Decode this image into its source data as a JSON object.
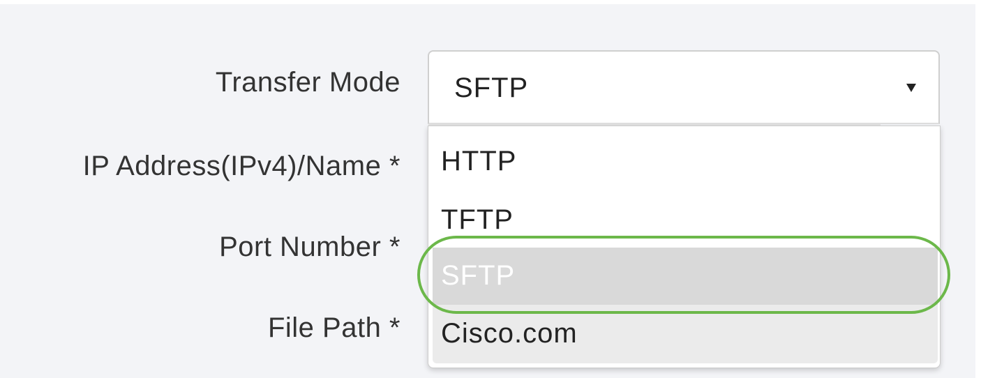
{
  "form": {
    "transfer_mode_label": "Transfer Mode",
    "ip_label": "IP Address(IPv4)/Name *",
    "port_label": "Port Number *",
    "file_path_label": "File Path *"
  },
  "transfer_mode_select": {
    "selected_value": "SFTP",
    "caret_icon": "caret-down-icon",
    "options": [
      {
        "label": "HTTP",
        "state": "normal"
      },
      {
        "label": "TFTP",
        "state": "normal"
      },
      {
        "label": "SFTP",
        "state": "highlighted"
      },
      {
        "label": "Cisco.com",
        "state": "hover"
      }
    ]
  },
  "colors": {
    "panel_background": "#f3f4f7",
    "highlight_ring": "#6cb84a",
    "selected_option_bg": "#d9d9d9",
    "hover_option_bg": "#ebebeb"
  }
}
